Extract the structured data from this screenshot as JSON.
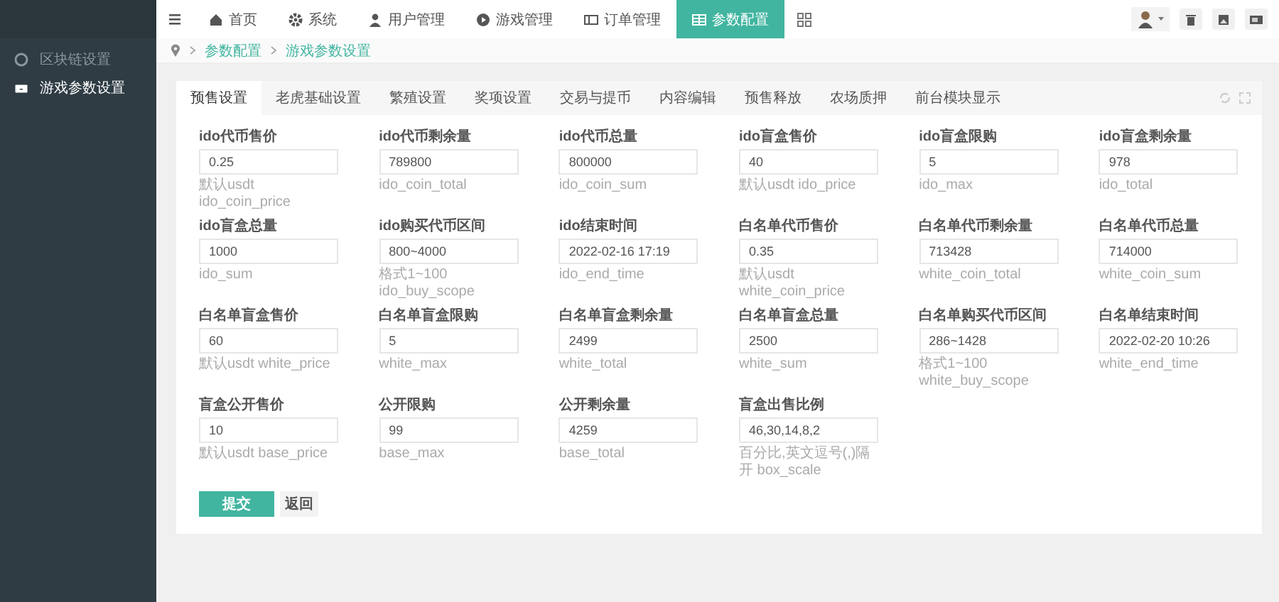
{
  "sidebar": {
    "items": [
      {
        "label": "区块链设置",
        "selected": false
      },
      {
        "label": "游戏参数设置",
        "selected": true
      }
    ]
  },
  "top_nav": {
    "items": [
      {
        "label": "首页",
        "selected": false
      },
      {
        "label": "系统",
        "selected": false
      },
      {
        "label": "用户管理",
        "selected": false
      },
      {
        "label": "游戏管理",
        "selected": false
      },
      {
        "label": "订单管理",
        "selected": false
      },
      {
        "label": "参数配置",
        "selected": true
      }
    ]
  },
  "breadcrumb": [
    "参数配置",
    "游戏参数设置"
  ],
  "tabs": [
    {
      "label": "预售设置",
      "selected": true
    },
    {
      "label": "老虎基础设置",
      "selected": false
    },
    {
      "label": "繁殖设置",
      "selected": false
    },
    {
      "label": "奖项设置",
      "selected": false
    },
    {
      "label": "交易与提币",
      "selected": false
    },
    {
      "label": "内容编辑",
      "selected": false
    },
    {
      "label": "预售释放",
      "selected": false
    },
    {
      "label": "农场质押",
      "selected": false
    },
    {
      "label": "前台模块显示",
      "selected": false
    }
  ],
  "fields": [
    {
      "label": "ido代币售价",
      "value": "0.25",
      "hint": "默认usdt ido_coin_price"
    },
    {
      "label": "ido代币剩余量",
      "value": "789800",
      "hint": "ido_coin_total"
    },
    {
      "label": "ido代币总量",
      "value": "800000",
      "hint": "ido_coin_sum"
    },
    {
      "label": "ido盲盒售价",
      "value": "40",
      "hint": "默认usdt ido_price"
    },
    {
      "label": "ido盲盒限购",
      "value": "5",
      "hint": "ido_max"
    },
    {
      "label": "ido盲盒剩余量",
      "value": "978",
      "hint": "ido_total"
    },
    {
      "label": "ido盲盒总量",
      "value": "1000",
      "hint": "ido_sum"
    },
    {
      "label": "ido购买代币区间",
      "value": "800~4000",
      "hint": "格式1~100 ido_buy_scope"
    },
    {
      "label": "ido结束时间",
      "value": "2022-02-16 17:19",
      "hint": "ido_end_time"
    },
    {
      "label": "白名单代币售价",
      "value": "0.35",
      "hint": "默认usdt white_coin_price"
    },
    {
      "label": "白名单代币剩余量",
      "value": "713428",
      "hint": "white_coin_total"
    },
    {
      "label": "白名单代币总量",
      "value": "714000",
      "hint": "white_coin_sum"
    },
    {
      "label": "白名单盲盒售价",
      "value": "60",
      "hint": "默认usdt white_price"
    },
    {
      "label": "白名单盲盒限购",
      "value": "5",
      "hint": "white_max"
    },
    {
      "label": "白名单盲盒剩余量",
      "value": "2499",
      "hint": "white_total"
    },
    {
      "label": "白名单盲盒总量",
      "value": "2500",
      "hint": "white_sum"
    },
    {
      "label": "白名单购买代币区间",
      "value": "286~1428",
      "hint": "格式1~100 white_buy_scope"
    },
    {
      "label": "白名单结束时间",
      "value": "2022-02-20 10:26",
      "hint": "white_end_time"
    },
    {
      "label": "盲盒公开售价",
      "value": "10",
      "hint": "默认usdt base_price"
    },
    {
      "label": "公开限购",
      "value": "99",
      "hint": "base_max"
    },
    {
      "label": "公开剩余量",
      "value": "4259",
      "hint": "base_total"
    },
    {
      "label": "盲盒出售比例",
      "value": "46,30,14,8,2",
      "hint": "百分比,英文逗号(,)隔开 box_scale"
    }
  ],
  "buttons": [
    {
      "label": "提交",
      "kind": "primary"
    },
    {
      "label": "返回",
      "kind": "default"
    }
  ]
}
